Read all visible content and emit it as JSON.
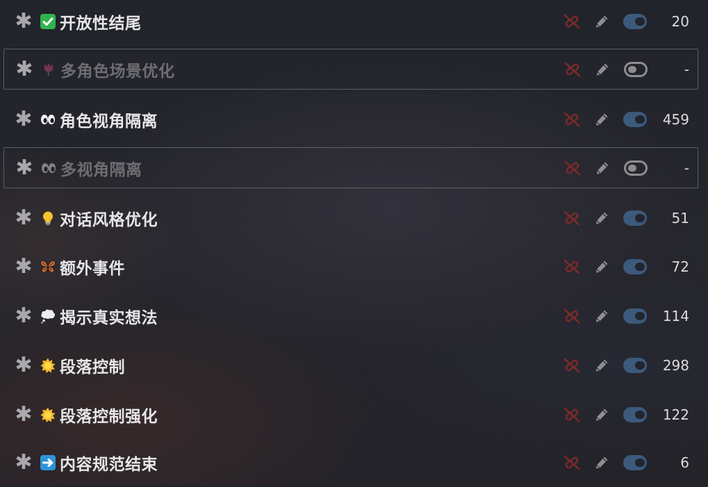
{
  "colors": {
    "background": "#24252c",
    "text": "#e6e6e8",
    "text_disabled": "#6d6d72",
    "toggle_on": "#3c5a7c",
    "toggle_off": "#8e8e92",
    "unlink_icon": "#7a2a2a",
    "pencil_icon": "#8f8f93"
  },
  "prompts": [
    {
      "emoji": "check-mark-icon",
      "label": "开放性结尾",
      "enabled": true,
      "count": "20"
    },
    {
      "emoji": "tulip-icon",
      "label": "多角色场景优化",
      "enabled": false,
      "count": "-"
    },
    {
      "emoji": "eyes-icon",
      "label": "角色视角隔离",
      "enabled": true,
      "count": "459"
    },
    {
      "emoji": "eyes-icon",
      "label": "多视角隔离",
      "enabled": false,
      "count": "-"
    },
    {
      "emoji": "light-bulb-icon",
      "label": "对话风格优化",
      "enabled": true,
      "count": "51"
    },
    {
      "emoji": "butterfly-icon",
      "label": "额外事件",
      "enabled": true,
      "count": "72"
    },
    {
      "emoji": "thought-balloon-icon",
      "label": "揭示真实想法",
      "enabled": true,
      "count": "114"
    },
    {
      "emoji": "sun-icon",
      "label": "段落控制",
      "enabled": true,
      "count": "298"
    },
    {
      "emoji": "sun-icon",
      "label": "段落控制强化",
      "enabled": true,
      "count": "122"
    },
    {
      "emoji": "right-arrow-icon",
      "label": "内容规范结束",
      "enabled": true,
      "count": "6"
    }
  ]
}
